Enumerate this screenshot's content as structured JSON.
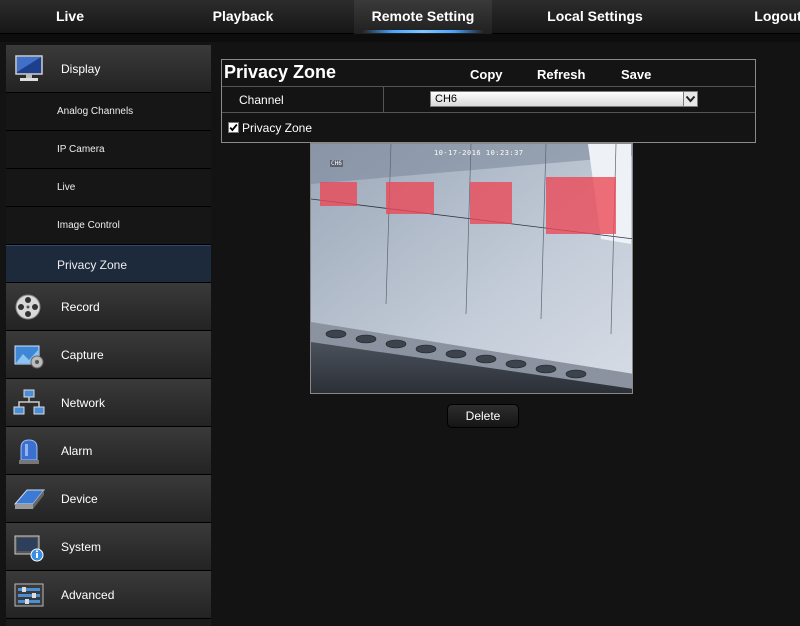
{
  "topnav": {
    "items": [
      {
        "label": "Live"
      },
      {
        "label": "Playback"
      },
      {
        "label": "Remote Setting",
        "active": true
      },
      {
        "label": "Local Settings"
      },
      {
        "label": "Logout"
      }
    ]
  },
  "sidebar": {
    "display": {
      "label": "Display",
      "icon": "monitor-icon",
      "subitems": [
        {
          "label": "Analog Channels"
        },
        {
          "label": "IP Camera"
        },
        {
          "label": "Live"
        },
        {
          "label": "Image Control"
        },
        {
          "label": "Privacy Zone",
          "active": true
        }
      ]
    },
    "categories": [
      {
        "label": "Record",
        "icon": "film-reel-icon"
      },
      {
        "label": "Capture",
        "icon": "camera-gear-icon"
      },
      {
        "label": "Network",
        "icon": "network-icon"
      },
      {
        "label": "Alarm",
        "icon": "alarm-light-icon"
      },
      {
        "label": "Device",
        "icon": "hard-drive-icon"
      },
      {
        "label": "System",
        "icon": "system-info-icon"
      },
      {
        "label": "Advanced",
        "icon": "advanced-settings-icon"
      }
    ]
  },
  "panel": {
    "title": "Privacy Zone",
    "copy_label": "Copy",
    "refresh_label": "Refresh",
    "save_label": "Save",
    "channel_label": "Channel",
    "channel_value": "CH6",
    "privacy_zone_label": "Privacy Zone",
    "privacy_zone_checked": true
  },
  "preview": {
    "osd_time": "10-17-2016 10:23:37",
    "osd_channel": "CH6",
    "zone_count": 4,
    "zone_color": "#ec4655"
  },
  "delete_label": "Delete",
  "colors": {
    "accent": "#4aa3ff",
    "active_bg": "#1c2a3c"
  }
}
